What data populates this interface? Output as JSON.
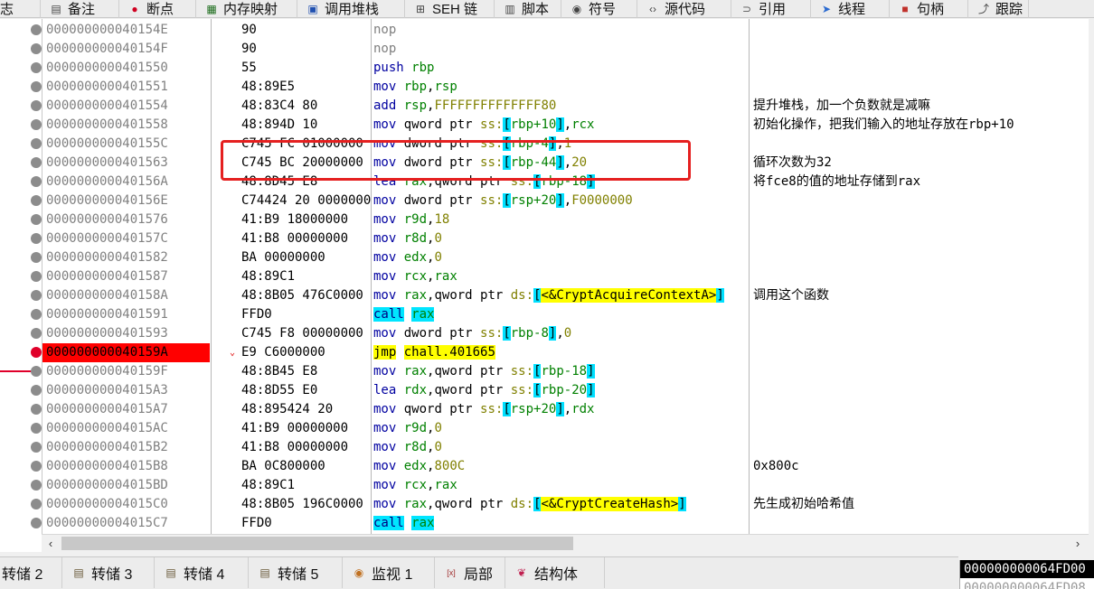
{
  "top_tabs": [
    {
      "label": "志",
      "icon": "log-icon"
    },
    {
      "label": "备注",
      "icon": "notes-icon"
    },
    {
      "label": "断点",
      "icon": "breakpoint-icon"
    },
    {
      "label": "内存映射",
      "icon": "memory-map-icon"
    },
    {
      "label": "调用堆栈",
      "icon": "call-stack-icon"
    },
    {
      "label": "SEH 链",
      "icon": "seh-chain-icon"
    },
    {
      "label": "脚本",
      "icon": "script-icon"
    },
    {
      "label": "符号",
      "icon": "symbols-icon"
    },
    {
      "label": "源代码",
      "icon": "source-code-icon"
    },
    {
      "label": "引用",
      "icon": "references-icon"
    },
    {
      "label": "线程",
      "icon": "threads-icon"
    },
    {
      "label": "句柄",
      "icon": "handles-icon"
    },
    {
      "label": "跟踪",
      "icon": "trace-icon"
    }
  ],
  "disasm": {
    "rows": [
      {
        "addr": "000000000040154E",
        "bytes": "90",
        "instr": "nop",
        "comment": ""
      },
      {
        "addr": "000000000040154F",
        "bytes": "90",
        "instr": "nop",
        "comment": ""
      },
      {
        "addr": "0000000000401550",
        "bytes": "55",
        "instr": "push rbp",
        "comment": ""
      },
      {
        "addr": "0000000000401551",
        "bytes": "48:89E5",
        "instr": "mov rbp,rsp",
        "comment": ""
      },
      {
        "addr": "0000000000401554",
        "bytes": "48:83C4 80",
        "instr": "add rsp,FFFFFFFFFFFFFF80",
        "comment": "提升堆栈，加一个负数就是减嘛"
      },
      {
        "addr": "0000000000401558",
        "bytes": "48:894D 10",
        "instr": "mov qword ptr ss:[rbp+10],rcx",
        "comment": "初始化操作，把我们输入的地址存放在rbp+10"
      },
      {
        "addr": "000000000040155C",
        "bytes": "C745 FC 01000000",
        "instr": "mov dword ptr ss:[rbp-4],1",
        "comment": ""
      },
      {
        "addr": "0000000000401563",
        "bytes": "C745 BC 20000000",
        "instr": "mov dword ptr ss:[rbp-44],20",
        "comment": "循环次数为32"
      },
      {
        "addr": "000000000040156A",
        "bytes": "48:8D45 E8",
        "instr": "lea rax,qword ptr ss:[rbp-18]",
        "comment": "将fce8的值的地址存储到rax"
      },
      {
        "addr": "000000000040156E",
        "bytes": "C74424 20 00000000",
        "instr": "mov dword ptr ss:[rsp+20],F0000000",
        "comment": ""
      },
      {
        "addr": "0000000000401576",
        "bytes": "41:B9 18000000",
        "instr": "mov r9d,18",
        "comment": ""
      },
      {
        "addr": "000000000040157C",
        "bytes": "41:B8 00000000",
        "instr": "mov r8d,0",
        "comment": ""
      },
      {
        "addr": "0000000000401582",
        "bytes": "BA 00000000",
        "instr": "mov edx,0",
        "comment": ""
      },
      {
        "addr": "0000000000401587",
        "bytes": "48:89C1",
        "instr": "mov rcx,rax",
        "comment": ""
      },
      {
        "addr": "000000000040158A",
        "bytes": "48:8B05 476C0000",
        "instr": "mov rax,qword ptr ds:[<&CryptAcquireContextA>]",
        "comment": "调用这个函数"
      },
      {
        "addr": "0000000000401591",
        "bytes": "FFD0",
        "instr": "call rax",
        "comment": ""
      },
      {
        "addr": "0000000000401593",
        "bytes": "C745 F8 00000000",
        "instr": "mov dword ptr ss:[rbp-8],0",
        "comment": ""
      },
      {
        "addr": "000000000040159A",
        "bytes": "E9 C6000000",
        "instr": "jmp chall.401665",
        "comment": ""
      },
      {
        "addr": "000000000040159F",
        "bytes": "48:8B45 E8",
        "instr": "mov rax,qword ptr ss:[rbp-18]",
        "comment": ""
      },
      {
        "addr": "00000000004015A3",
        "bytes": "48:8D55 E0",
        "instr": "lea rdx,qword ptr ss:[rbp-20]",
        "comment": ""
      },
      {
        "addr": "00000000004015A7",
        "bytes": "48:895424 20",
        "instr": "mov qword ptr ss:[rsp+20],rdx",
        "comment": ""
      },
      {
        "addr": "00000000004015AC",
        "bytes": "41:B9 00000000",
        "instr": "mov r9d,0",
        "comment": ""
      },
      {
        "addr": "00000000004015B2",
        "bytes": "41:B8 00000000",
        "instr": "mov r8d,0",
        "comment": ""
      },
      {
        "addr": "00000000004015B8",
        "bytes": "BA 0C800000",
        "instr": "mov edx,800C",
        "comment": "0x800c"
      },
      {
        "addr": "00000000004015BD",
        "bytes": "48:89C1",
        "instr": "mov rcx,rax",
        "comment": ""
      },
      {
        "addr": "00000000004015C0",
        "bytes": "48:8B05 196C0000",
        "instr": "mov rax,qword ptr ds:[<&CryptCreateHash>]",
        "comment": "先生成初始哈希值"
      },
      {
        "addr": "00000000004015C7",
        "bytes": "FFD0",
        "instr": "call rax",
        "comment": ""
      }
    ],
    "selected_addr": "000000000040159A"
  },
  "bottom_tabs": [
    {
      "label": "转储 2",
      "icon": "dump-icon"
    },
    {
      "label": "转储 3",
      "icon": "dump-icon"
    },
    {
      "label": "转储 4",
      "icon": "dump-icon"
    },
    {
      "label": "转储 5",
      "icon": "dump-icon"
    },
    {
      "label": "监视 1",
      "icon": "watch-icon"
    },
    {
      "label": "局部",
      "icon": "locals-icon"
    },
    {
      "label": "结构体",
      "icon": "struct-icon"
    }
  ],
  "stack_address": {
    "current": "000000000064FD00",
    "next": "000000000064FD08"
  },
  "colors": {
    "selected_row": "#ff0000",
    "annotation_box": "#e52020",
    "memory_operand_bg": "#00e0ff",
    "jump_highlight": "#ffff00"
  }
}
